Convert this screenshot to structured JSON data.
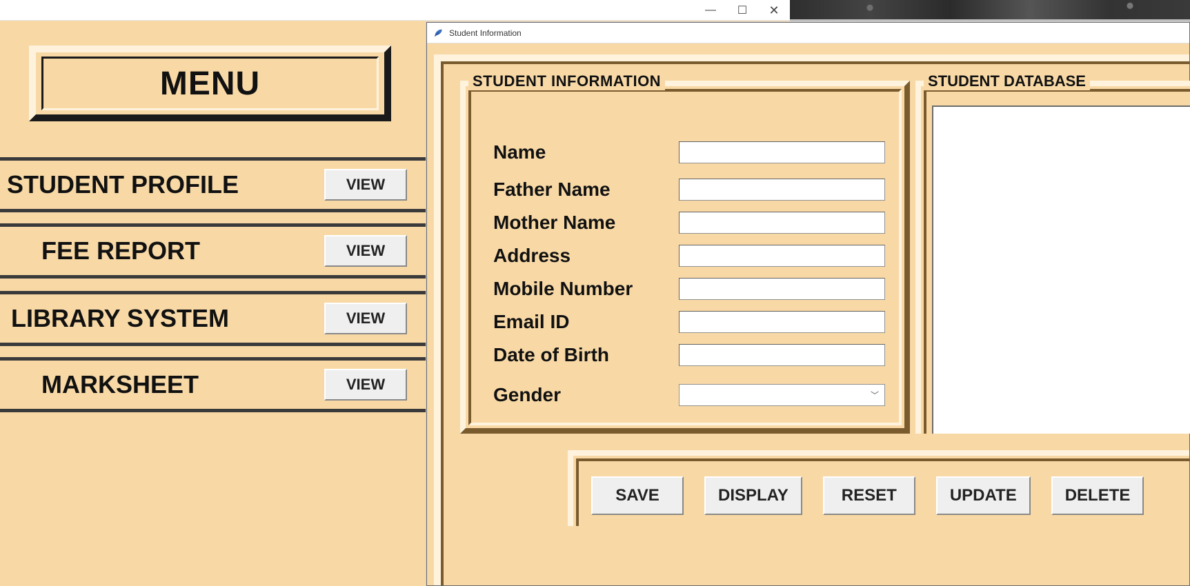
{
  "colors": {
    "panel_bg": "#f8d9a6",
    "ridge_light": "#fff3de",
    "ridge_dark": "#7a5b2e"
  },
  "main_window": {
    "controls": {
      "minimize": "—",
      "maximize": "☐",
      "close": "✕"
    }
  },
  "menu": {
    "title": "MENU",
    "items": [
      {
        "label": "STUDENT PROFILE",
        "button": "VIEW"
      },
      {
        "label": "FEE REPORT",
        "button": "VIEW"
      },
      {
        "label": "LIBRARY SYSTEM",
        "button": "VIEW"
      },
      {
        "label": "MARKSHEET",
        "button": "VIEW"
      }
    ]
  },
  "child_window": {
    "title": "Student Information"
  },
  "student_info": {
    "legend": "STUDENT INFORMATION",
    "fields": {
      "name": {
        "label": "Name",
        "value": ""
      },
      "father_name": {
        "label": "Father Name",
        "value": ""
      },
      "mother_name": {
        "label": "Mother Name",
        "value": ""
      },
      "address": {
        "label": "Address",
        "value": ""
      },
      "mobile": {
        "label": "Mobile Number",
        "value": ""
      },
      "email": {
        "label": "Email ID",
        "value": ""
      },
      "dob": {
        "label": "Date of Birth",
        "value": ""
      },
      "gender": {
        "label": "Gender",
        "value": ""
      }
    }
  },
  "student_database": {
    "legend": "STUDENT DATABASE"
  },
  "actions": {
    "save": "SAVE",
    "display": "DISPLAY",
    "reset": "RESET",
    "update": "UPDATE",
    "delete": "DELETE"
  }
}
